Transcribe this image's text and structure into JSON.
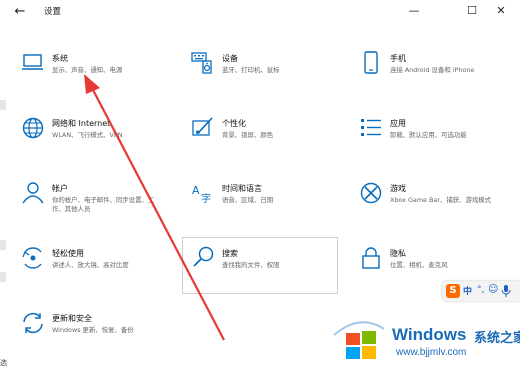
{
  "window": {
    "title": "设置",
    "back_icon": "←",
    "minimize_icon": "—",
    "maximize_icon": "☐",
    "close_icon": "✕"
  },
  "tiles": [
    {
      "title": "系统",
      "subtitle": "显示、声音、通知、电源",
      "icon": "laptop-icon"
    },
    {
      "title": "设备",
      "subtitle": "蓝牙、打印机、鼠标",
      "icon": "keyboard-speaker-icon"
    },
    {
      "title": "手机",
      "subtitle": "连接 Android 设备和 iPhone",
      "icon": "phone-icon"
    },
    {
      "title": "网络和 Internet",
      "subtitle": "WLAN、飞行模式、VPN",
      "icon": "globe-icon"
    },
    {
      "title": "个性化",
      "subtitle": "背景、锁屏、颜色",
      "icon": "paint-icon"
    },
    {
      "title": "应用",
      "subtitle": "卸载、默认应用、可选功能",
      "icon": "apps-list-icon"
    },
    {
      "title": "帐户",
      "subtitle": "你的帐户、电子邮件、同步设置、工作、其他人员",
      "icon": "person-icon"
    },
    {
      "title": "时间和语言",
      "subtitle": "语音、区域、日期",
      "icon": "time-language-icon"
    },
    {
      "title": "游戏",
      "subtitle": "Xbox Game Bar、捕获、游戏模式",
      "icon": "xbox-icon"
    },
    {
      "title": "轻松使用",
      "subtitle": "讲述人、放大镜、高对比度",
      "icon": "ease-of-access-icon"
    },
    {
      "title": "搜索",
      "subtitle": "查找我的文件、权限",
      "icon": "search-icon"
    },
    {
      "title": "隐私",
      "subtitle": "位置、相机、麦克风",
      "icon": "lock-icon"
    },
    {
      "title": "更新和安全",
      "subtitle": "Windows 更新、恢复、备份",
      "icon": "update-icon"
    }
  ],
  "ime": {
    "logo": "S",
    "lang": "中",
    "punct": "°,",
    "emoji": "☺",
    "mic": "🎤"
  },
  "watermark": {
    "brand": "Windows",
    "brand_cn": "系统之家",
    "url": "www.bjjmlv.com"
  },
  "edge_text": "选",
  "colors": {
    "accent": "#0a6cbd",
    "arrow": "#e53935"
  }
}
